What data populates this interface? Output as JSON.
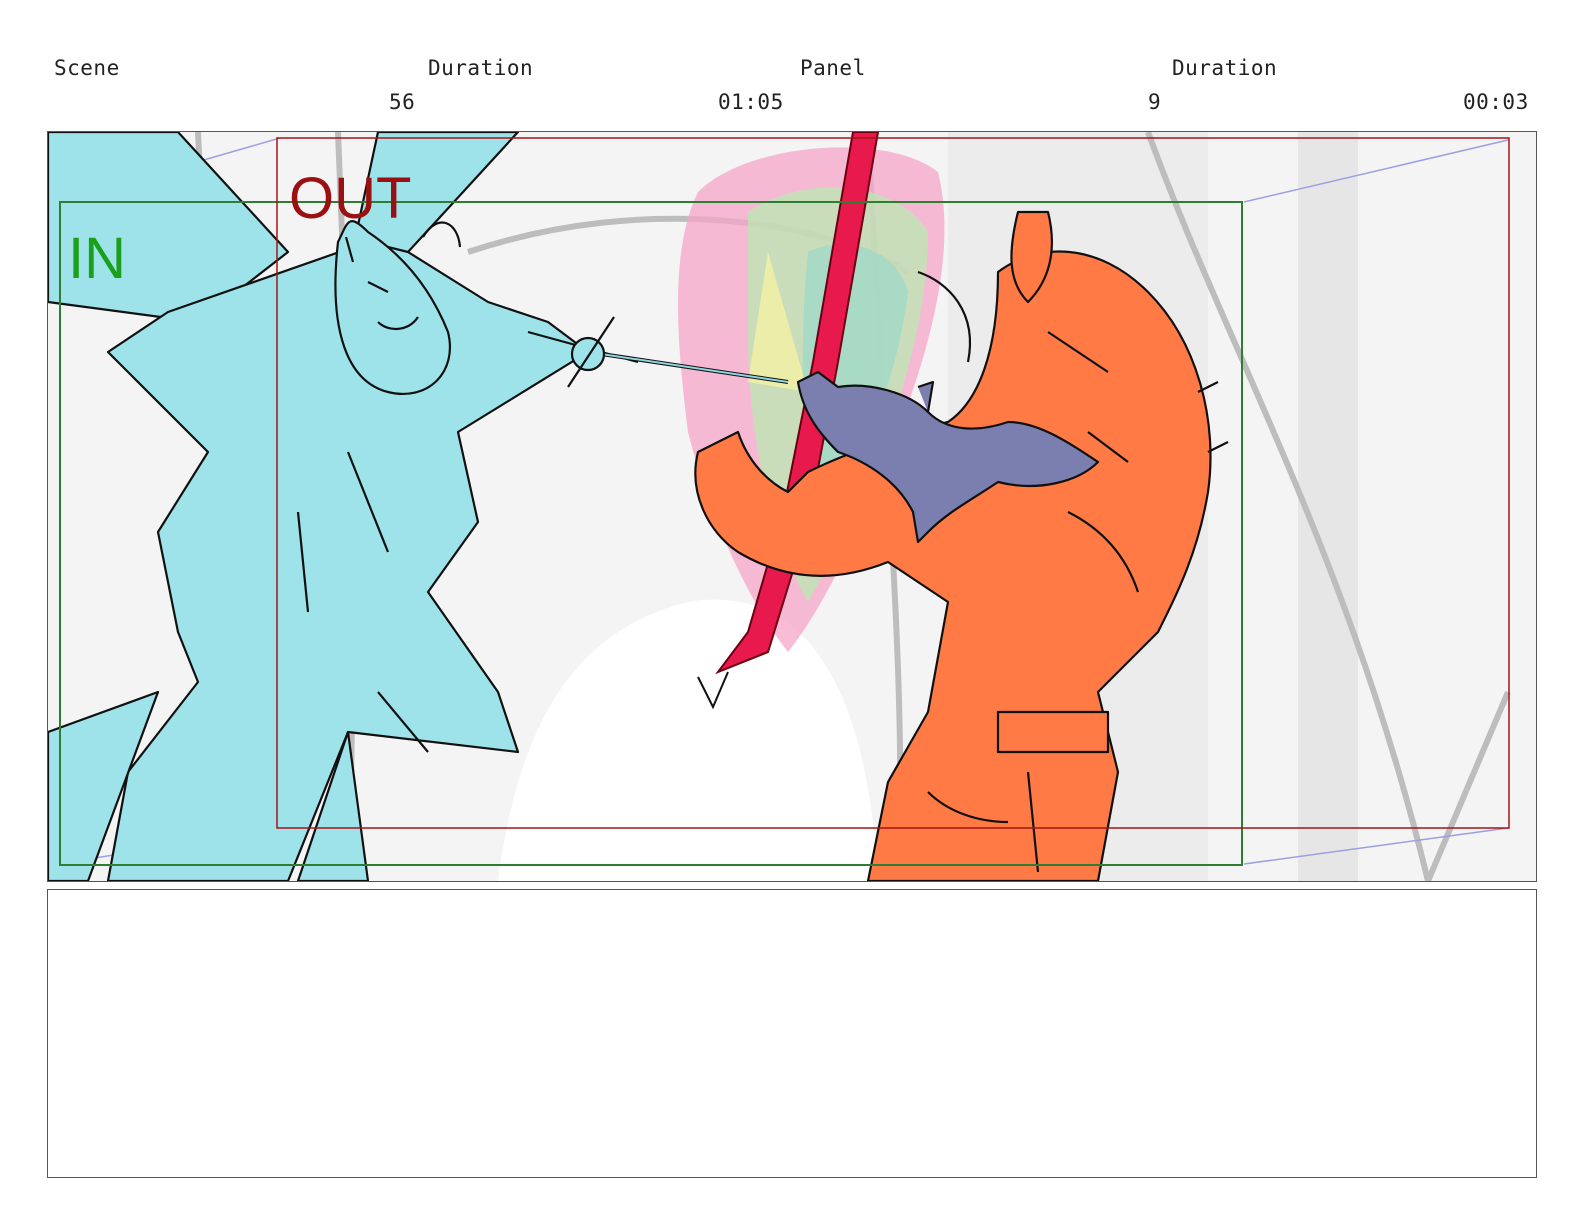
{
  "header": {
    "scene_label": "Scene",
    "duration_label_1": "Duration",
    "panel_label": "Panel",
    "duration_label_2": "Duration",
    "scene_value": "56",
    "scene_duration_value": "01:05",
    "panel_value": "9",
    "panel_duration_value": "00:03"
  },
  "panel": {
    "in_label": "IN",
    "out_label": "OUT",
    "colors": {
      "in_frame": "#2e7d32",
      "in_text": "#1aa01a",
      "out_frame": "#a31515",
      "out_text": "#9b1010",
      "left_character": "#9fe3ea",
      "right_character": "#ff7a45",
      "cat": "#7b7fb0",
      "sword": "#e8194c",
      "camera_move": "#9aa0e0"
    },
    "icons": [
      "left-character-drawing",
      "right-character-drawing",
      "cat-drawing",
      "sword-drawing",
      "magic-burst-drawing"
    ]
  },
  "notes": {
    "text": ""
  }
}
